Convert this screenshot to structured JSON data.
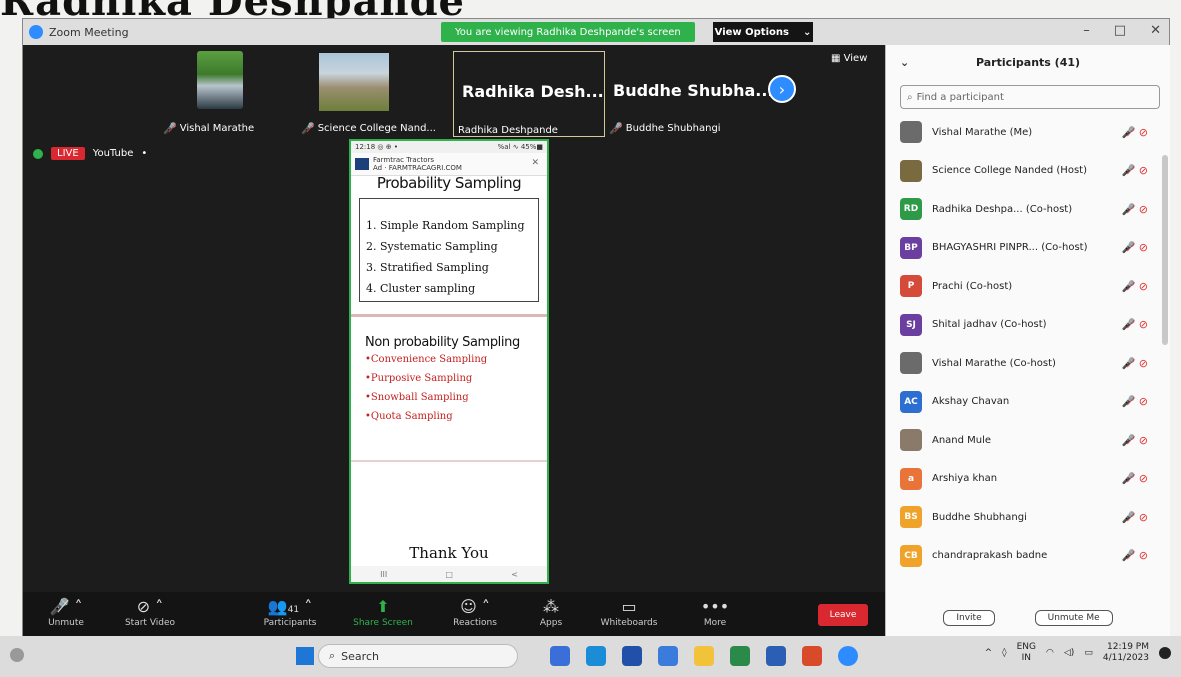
{
  "page_heading": "Radhika Deshpande",
  "titlebar": {
    "app_title": "Zoom Meeting",
    "viewing_text": "You are viewing Radhika Deshpande's screen",
    "view_options": "View Options",
    "controls": [
      "–",
      "□",
      "✕"
    ]
  },
  "thumbnails": [
    {
      "name": "Vishal Marathe"
    },
    {
      "name": "Science College Nand..."
    },
    {
      "big": "Radhika Desh...",
      "name": "Radhika Deshpande"
    },
    {
      "big": "Buddhe Shubha...",
      "name": "Buddhe Shubhangi"
    }
  ],
  "view_label": "View",
  "live": {
    "badge": "LIVE",
    "platform": "YouTube"
  },
  "shared_screen": {
    "status_left": "12:18 ◎ ⊕ •",
    "status_right": "%al ∿ 45%■",
    "ad_name": "Farmtrac Tractors",
    "ad_url": "Ad · FARMTRACAGRI.COM",
    "slide1_title": "Probability Sampling",
    "slide1_items": [
      "1. Simple Random Sampling",
      "2. Systematic Sampling",
      "3. Stratified Sampling",
      "4. Cluster sampling"
    ],
    "slide2_title": "Non probability Sampling",
    "slide2_items": [
      "•Convenience Sampling",
      "•Purposive Sampling",
      "•Snowball Sampling",
      "•Quota Sampling"
    ],
    "thankyou": "Thank You",
    "nav": [
      "III",
      "□",
      "<"
    ]
  },
  "toolbar": {
    "unmute": "Unmute",
    "start_video": "Start Video",
    "participants": "Participants",
    "participant_count": "41",
    "share_screen": "Share Screen",
    "reactions": "Reactions",
    "apps": "Apps",
    "whiteboards": "Whiteboards",
    "more": "More",
    "leave": "Leave"
  },
  "participants_panel": {
    "title": "Participants (41)",
    "search_placeholder": "Find a participant",
    "list": [
      {
        "initials": "",
        "name": "Vishal Marathe (Me)",
        "color": "#6b6b6b"
      },
      {
        "initials": "",
        "name": "Science College Nanded (Host)",
        "color": "#7a6a40"
      },
      {
        "initials": "RD",
        "name": "Radhika Deshpa...  (Co-host)",
        "color": "#2e9a47"
      },
      {
        "initials": "BP",
        "name": "BHAGYASHRI PINPR...  (Co-host)",
        "color": "#6a3fa0"
      },
      {
        "initials": "P",
        "name": "Prachi (Co-host)",
        "color": "#d64a3a"
      },
      {
        "initials": "SJ",
        "name": "Shital jadhav (Co-host)",
        "color": "#6a3fa0"
      },
      {
        "initials": "",
        "name": "Vishal Marathe (Co-host)",
        "color": "#6b6b6b"
      },
      {
        "initials": "AC",
        "name": "Akshay Chavan",
        "color": "#2d6fd1"
      },
      {
        "initials": "",
        "name": "Anand Mule",
        "color": "#8a7a6a"
      },
      {
        "initials": "a",
        "name": "Arshiya khan",
        "color": "#e8743a"
      },
      {
        "initials": "BS",
        "name": "Buddhe Shubhangi",
        "color": "#f0a32a"
      },
      {
        "initials": "CB",
        "name": "chandraprakash badne",
        "color": "#f0a32a"
      }
    ],
    "invite": "Invite",
    "unmute_me": "Unmute Me"
  },
  "taskbar": {
    "search": "Search",
    "lang": "ENG",
    "region": "IN",
    "time": "12:19 PM",
    "date": "4/11/2023"
  }
}
